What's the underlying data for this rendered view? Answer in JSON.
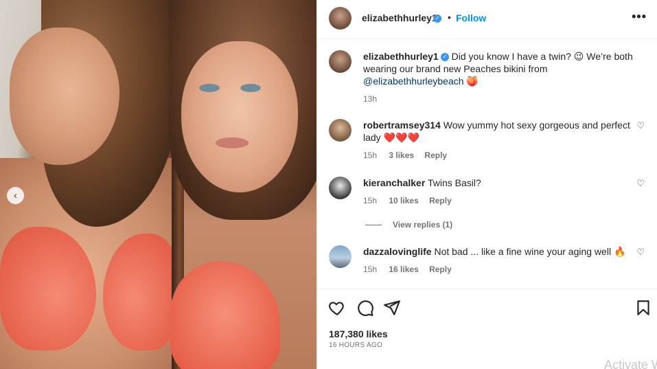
{
  "post": {
    "username": "elizabethhurley1",
    "verified_mark": "✓",
    "separator": "•",
    "follow_label": "Follow",
    "more_label": "•••",
    "caption_text": "Did you know I have a twin? 😉 We’re both wearing our brand new Peaches bikini from",
    "caption_mention": "@elizabethhurleybeach",
    "caption_emoji": "🍑",
    "caption_time": "13h"
  },
  "comments": [
    {
      "username": "robertramsey314",
      "text": "Wow yummy hot sexy gorgeous and perfect lady",
      "emoji": "❤️❤️❤️",
      "time": "15h",
      "likes": "3 likes",
      "reply": "Reply"
    },
    {
      "username": "kieranchalker",
      "text": "Twins Basil?",
      "time": "15h",
      "likes": "10 likes",
      "reply": "Reply"
    },
    {
      "username": "dazzalovinglife",
      "text": "Not bad ... like a fine wine your aging well",
      "emoji": "🔥",
      "time": "15h",
      "likes": "16 likes",
      "reply": "Reply"
    }
  ],
  "view_replies_label": "View replies (1)",
  "likes_count": "187,380 likes",
  "posted_ago": "16 HOURS AGO",
  "watermark": "Activate W",
  "colors": {
    "link": "#0095f6",
    "mention": "#00376b",
    "muted": "#737373",
    "heart": "#ed4956"
  }
}
